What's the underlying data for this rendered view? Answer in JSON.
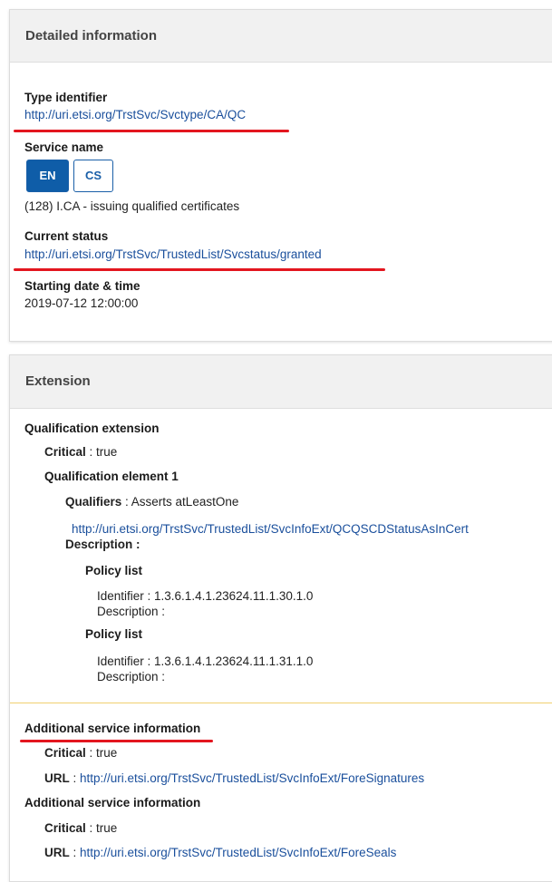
{
  "detailed": {
    "header": "Detailed information",
    "type_identifier_label": "Type identifier",
    "type_identifier_value": "http://uri.etsi.org/TrstSvc/Svctype/CA/QC",
    "service_name_label": "Service name",
    "lang_buttons": [
      "EN",
      "CS"
    ],
    "service_name_value": "(128) I.CA - issuing qualified certificates",
    "current_status_label": "Current status",
    "current_status_value": "http://uri.etsi.org/TrstSvc/TrustedList/Svcstatus/granted",
    "starting_label": "Starting date & time",
    "starting_value": "2019-07-12 12:00:00"
  },
  "extension": {
    "header": "Extension",
    "qualification_extension_label": "Qualification extension",
    "critical_label": "Critical",
    "critical_value": " : true",
    "qualification_element_label": "Qualification element 1",
    "qualifiers_label": "Qualifiers",
    "qualifiers_value": " : Asserts atLeastOne",
    "qualifier_uri": "http://uri.etsi.org/TrstSvc/TrustedList/SvcInfoExt/QCQSCDStatusAsInCert",
    "description_label": "Description",
    "description_colon": " :",
    "policy_list_1_label": "Policy list",
    "policy_1_identifier": "Identifier : 1.3.6.1.4.1.23624.11.1.30.1.0",
    "policy_1_description": "Description :",
    "policy_list_2_label": "Policy list",
    "policy_2_identifier": "Identifier : 1.3.6.1.4.1.23624.11.1.31.1.0",
    "policy_2_description": "Description :",
    "additional_1": {
      "label": "Additional service information",
      "critical_label": "Critical",
      "critical_value": " : true",
      "url_label": "URL",
      "url_sep": " : ",
      "url_value": "http://uri.etsi.org/TrstSvc/TrustedList/SvcInfoExt/ForeSignatures"
    },
    "additional_2": {
      "label": "Additional service information",
      "critical_label": "Critical",
      "critical_value": " : true",
      "url_label": "URL",
      "url_sep": " : ",
      "url_value": "http://uri.etsi.org/TrstSvc/TrustedList/SvcInfoExt/ForeSeals"
    }
  },
  "colors": {
    "link": "#1a4f9c",
    "annotation_underline": "#e3161f",
    "lang_active_bg": "#0f5da8",
    "divider": "#f0d070"
  }
}
